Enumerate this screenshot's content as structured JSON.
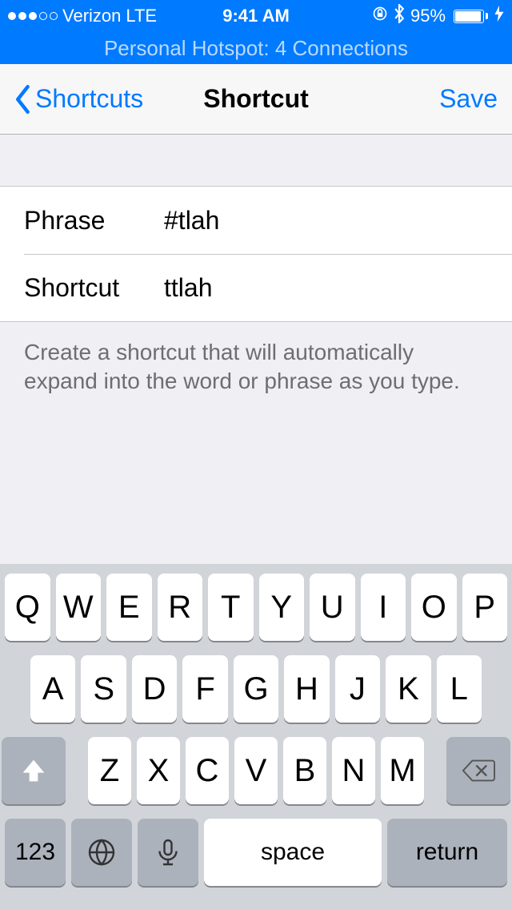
{
  "status": {
    "carrier": "Verizon",
    "network": "LTE",
    "time": "9:41 AM",
    "battery_pct": "95%"
  },
  "hotspot": {
    "text": "Personal Hotspot: 4 Connections"
  },
  "nav": {
    "back_label": "Shortcuts",
    "title": "Shortcut",
    "save_label": "Save"
  },
  "form": {
    "phrase_label": "Phrase",
    "phrase_value": "#tlah",
    "shortcut_label": "Shortcut",
    "shortcut_value": "ttlah",
    "help_text": "Create a shortcut that will automatically expand into the word or phrase as you type."
  },
  "keyboard": {
    "row1": [
      "Q",
      "W",
      "E",
      "R",
      "T",
      "Y",
      "U",
      "I",
      "O",
      "P"
    ],
    "row2": [
      "A",
      "S",
      "D",
      "F",
      "G",
      "H",
      "J",
      "K",
      "L"
    ],
    "row3": [
      "Z",
      "X",
      "C",
      "V",
      "B",
      "N",
      "M"
    ],
    "num_label": "123",
    "space_label": "space",
    "return_label": "return"
  }
}
